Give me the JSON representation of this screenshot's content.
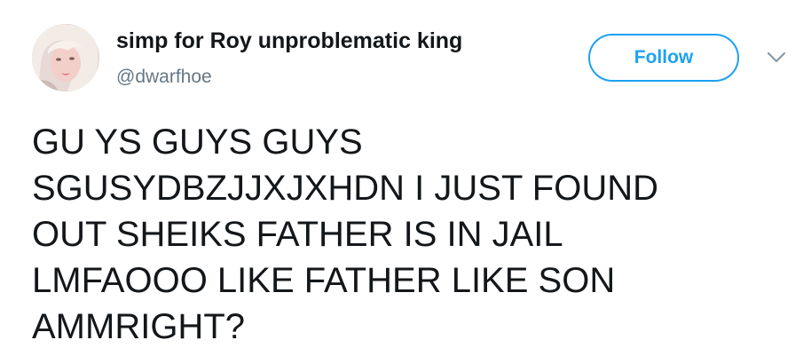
{
  "user": {
    "display_name": "simp for Roy unproblematic king",
    "handle": "@dwarfhoe"
  },
  "actions": {
    "follow_label": "Follow",
    "more_icon": "chevron-down-icon"
  },
  "tweet": {
    "lines": [
      "GU YS GUYS GUYS",
      "SGUSYDBZJJXJXHDN I JUST FOUND",
      "OUT SHEIKS FATHER IS IN JAIL",
      "LMFAOOO LIKE FATHER LIKE SON",
      "AMMRIGHT?"
    ]
  },
  "colors": {
    "accent": "#1da1f2",
    "text": "#14171a",
    "secondary": "#657786"
  }
}
